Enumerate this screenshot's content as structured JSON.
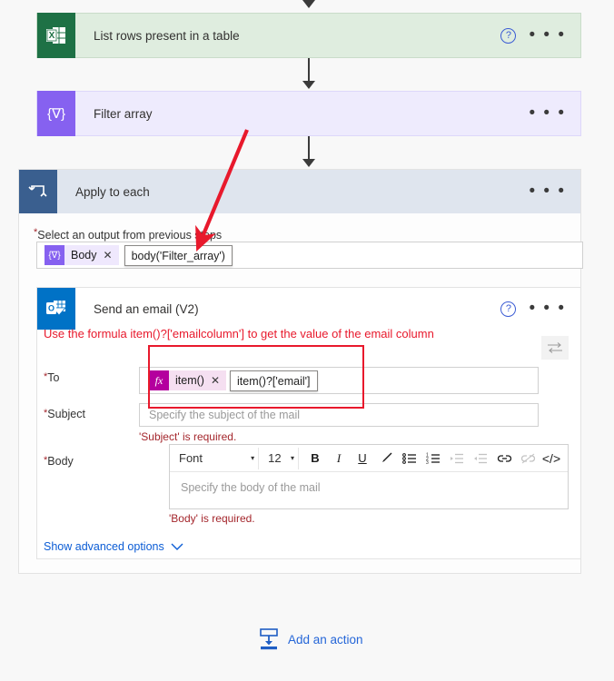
{
  "flow": {
    "steps": [
      {
        "id": "list-rows",
        "title": "List rows present in a table",
        "icon": "excel-icon",
        "help_icon": "?",
        "menu_icon": "• • •"
      },
      {
        "id": "filter-array",
        "title": "Filter array",
        "icon": "filter-array-icon",
        "glyph": "{∇}",
        "menu_icon": "• • •"
      },
      {
        "id": "apply-to-each",
        "title": "Apply to each",
        "icon": "loop-icon",
        "menu_icon": "• • •"
      }
    ]
  },
  "apply_to_each": {
    "select_output": {
      "label": "Select an output from previous steps",
      "required_marker": "*",
      "token": {
        "badge_glyph": "{∇}",
        "text": "Body",
        "remove_glyph": "✕"
      },
      "tooltip": "body('Filter_array')"
    }
  },
  "send_email": {
    "title": "Send an email (V2)",
    "icon": "outlook-icon",
    "help_icon": "?",
    "menu_icon": "• • •",
    "swap_icon": "swap-arrows-icon",
    "annotation": "Use the formula item()?['emailcolumn'] to get the value of the email column",
    "fields": {
      "to": {
        "label": "To",
        "required_marker": "*",
        "token": {
          "badge_glyph": "fx",
          "text": "item()",
          "remove_glyph": "✕"
        },
        "tooltip": "item()?['email']"
      },
      "subject": {
        "label": "Subject",
        "required_marker": "*",
        "placeholder": "Specify the subject of the mail",
        "error": "'Subject' is required."
      },
      "body": {
        "label": "Body",
        "required_marker": "*",
        "placeholder": "Specify the body of the mail",
        "error": "'Body' is required."
      }
    },
    "rich_text_toolbar": {
      "font_name": "Font",
      "font_size": "12",
      "caret": "▾",
      "buttons": [
        {
          "name": "bold-icon",
          "glyph": "B"
        },
        {
          "name": "italic-icon",
          "glyph": "I"
        },
        {
          "name": "underline-icon",
          "glyph": "U"
        },
        {
          "name": "text-color-pen-icon",
          "glyph": "✎"
        },
        {
          "name": "bulleted-list-icon",
          "glyph": "☰"
        },
        {
          "name": "numbered-list-icon",
          "glyph": "☰"
        },
        {
          "name": "indent-increase-icon",
          "glyph": "☰"
        },
        {
          "name": "indent-decrease-icon",
          "glyph": "☰"
        },
        {
          "name": "link-icon",
          "glyph": "🔗"
        },
        {
          "name": "unlink-icon",
          "glyph": "🔗"
        },
        {
          "name": "code-view-icon",
          "glyph": "</>"
        }
      ]
    },
    "show_advanced_options": {
      "label": "Show advanced options",
      "chevron": "⌄"
    }
  },
  "footer": {
    "add_action": {
      "label": "Add an action",
      "icon": "insert-action-icon"
    }
  },
  "colors": {
    "excel_green": "#1e7145",
    "excel_card_bg": "#dfeddf",
    "filter_purple": "#8661f0",
    "filter_card_bg": "#eeebfd",
    "loop_blue": "#3a5f8f",
    "loop_header_bg": "#dfe5ee",
    "outlook_blue": "#0072c6",
    "annotation_red": "#e8192c",
    "error_red": "#a4262c",
    "link_blue": "#0b5cd5",
    "token_magenta": "#b4009e"
  }
}
